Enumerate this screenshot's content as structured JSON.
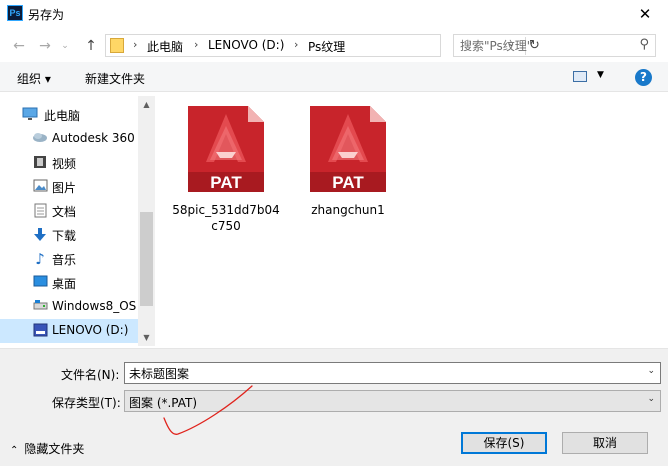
{
  "window": {
    "title": "另存为",
    "app_icon_text": "Ps",
    "close_glyph": "✕"
  },
  "address_bar": {
    "back_glyph": "←",
    "forward_glyph": "→",
    "up_glyph": "↑",
    "path": [
      "此电脑",
      "LENOVO (D:)",
      "Ps纹理"
    ],
    "separator": "›",
    "dropdown_glyph": "⌄",
    "refresh_glyph": "↻"
  },
  "search": {
    "placeholder": "搜索\"Ps纹理\"",
    "icon": "search-icon"
  },
  "toolbar": {
    "organize_label": "组织 ▾",
    "new_folder_label": "新建文件夹",
    "help_glyph": "?"
  },
  "nav_pane": {
    "items": [
      {
        "label": "此电脑",
        "icon": "computer-icon"
      },
      {
        "label": "Autodesk 360",
        "icon": "cloud-icon"
      },
      {
        "label": "视频",
        "icon": "video-icon"
      },
      {
        "label": "图片",
        "icon": "picture-icon"
      },
      {
        "label": "文档",
        "icon": "document-icon"
      },
      {
        "label": "下载",
        "icon": "download-icon"
      },
      {
        "label": "音乐",
        "icon": "music-icon"
      },
      {
        "label": "桌面",
        "icon": "desktop-icon"
      },
      {
        "label": "Windows8_OS",
        "icon": "drive-icon"
      },
      {
        "label": "LENOVO (D:)",
        "icon": "drive-icon",
        "selected": true
      }
    ],
    "scroll_up_glyph": "▲",
    "scroll_down_glyph": "▼"
  },
  "files": [
    {
      "name": "58pic_531dd7b04c750",
      "badge": "PAT"
    },
    {
      "name": "zhangchun1",
      "badge": "PAT"
    }
  ],
  "form": {
    "filename_label": "文件名(N):",
    "filename_value": "未标题图案",
    "filetype_label": "保存类型(T):",
    "filetype_value": "图案 (*.PAT)",
    "dropdown_glyph": "⌄"
  },
  "footer": {
    "hide_folders_label": "隐藏文件夹",
    "hide_folders_glyph": "⌃",
    "save_label": "保存(S)",
    "cancel_label": "取消"
  },
  "colors": {
    "accent": "#0078d7",
    "selection": "#cce8ff",
    "pat_red": "#c8242b",
    "annotation_red": "#e0231c"
  }
}
